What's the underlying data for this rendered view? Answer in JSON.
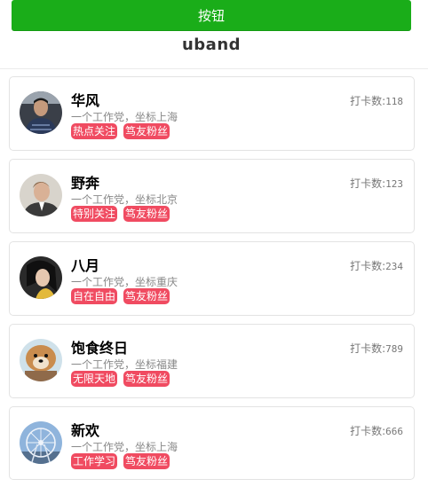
{
  "button": {
    "label": "按钮",
    "color": "#1aad19"
  },
  "logo": {
    "text": "uband"
  },
  "count_label": "打卡数:",
  "tag_color": "#f04b61",
  "cards": [
    {
      "name": "华风",
      "desc": "一个工作党，坐标上海",
      "tags": [
        "热点关注",
        "笃友粉丝"
      ],
      "count": "118",
      "avatar": "avatar-man-sweater"
    },
    {
      "name": "野奔",
      "desc": "一个工作党，坐标北京",
      "tags": [
        "特别关注",
        "笃友粉丝"
      ],
      "count": "123",
      "avatar": "avatar-man-suit"
    },
    {
      "name": "八月",
      "desc": "一个工作党，坐标重庆",
      "tags": [
        "自在自由",
        "笃友粉丝"
      ],
      "count": "234",
      "avatar": "avatar-woman"
    },
    {
      "name": "饱食终日",
      "desc": "一个工作党，坐标福建",
      "tags": [
        "无限天地",
        "笃友粉丝"
      ],
      "count": "789",
      "avatar": "avatar-dog"
    },
    {
      "name": "新欢",
      "desc": "一个工作党，坐标上海",
      "tags": [
        "工作学习",
        "笃友粉丝"
      ],
      "count": "666",
      "avatar": "avatar-ferris-wheel"
    }
  ]
}
